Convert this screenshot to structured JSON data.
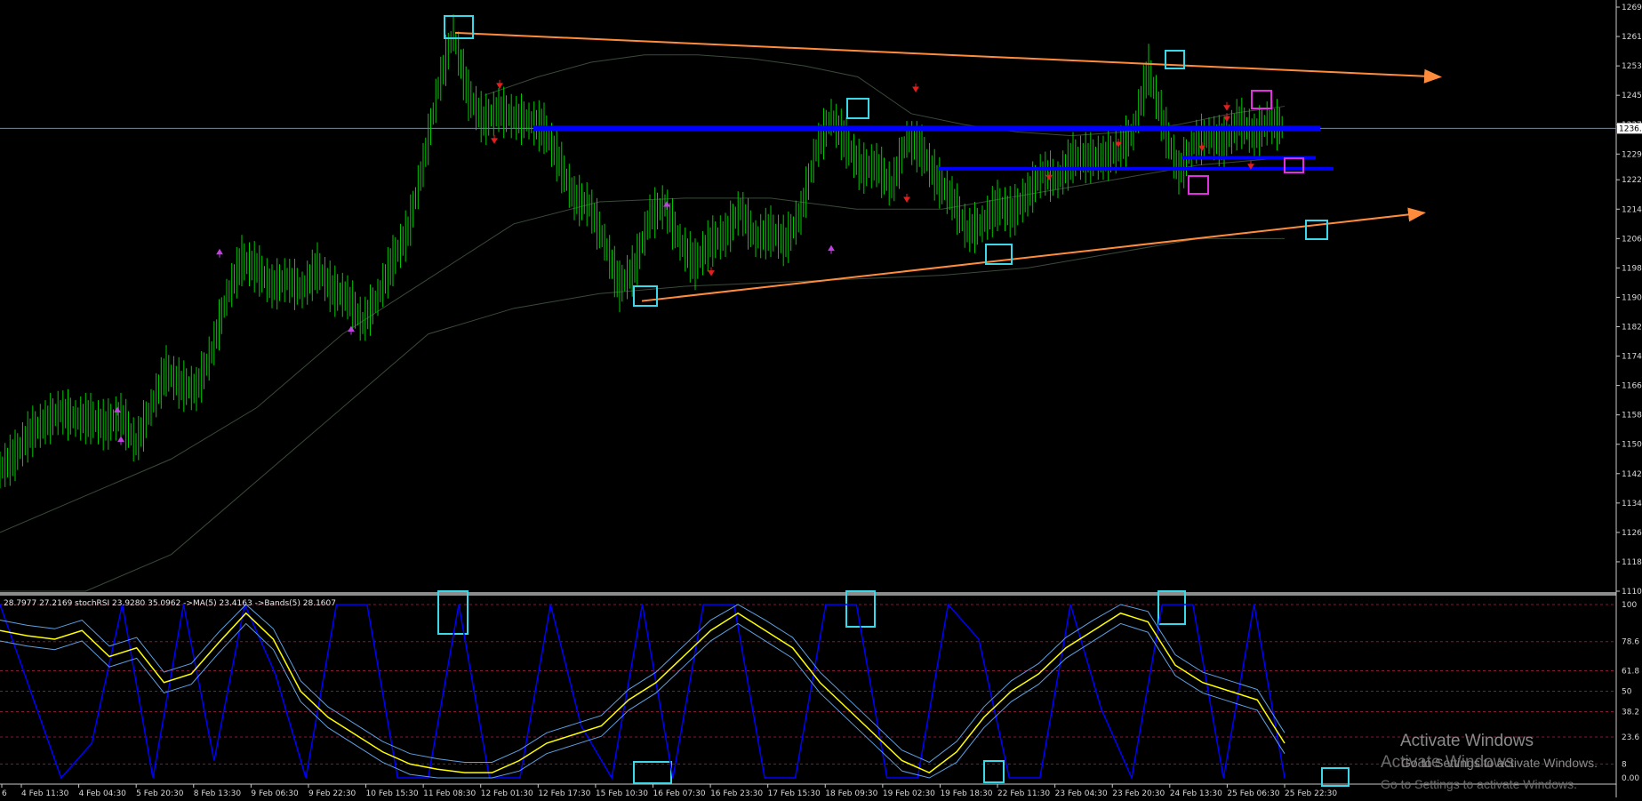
{
  "chart_data": [
    {
      "type": "line",
      "panel": "price",
      "y_ticks": [
        "1269",
        "1261",
        "1253",
        "1245",
        "1237",
        "1229",
        "1222",
        "1214",
        "1206",
        "1198",
        "1190",
        "1182",
        "1174",
        "1166",
        "1158",
        "1150",
        "1142",
        "1134",
        "1126",
        "1118",
        "1110"
      ],
      "ylim": [
        1110,
        1269
      ],
      "current_price_label": "1236.",
      "current_price": 1236,
      "x_tick_labels": [
        "6",
        "4 Feb 11:30",
        "4 Feb 04:30",
        "5 Feb 20:30",
        "8 Feb 13:30",
        "9 Feb 06:30",
        "9 Feb 22:30",
        "10 Feb 15:30",
        "11 Feb 08:30",
        "12 Feb 01:30",
        "12 Feb 17:30",
        "15 Feb 10:30",
        "16 Feb 07:30",
        "16 Feb 23:30",
        "17 Feb 15:30",
        "18 Feb 09:30",
        "19 Feb 02:30",
        "19 Feb 18:30",
        "22 Feb 11:30",
        "23 Feb 04:30",
        "23 Feb 20:30",
        "24 Feb 13:30",
        "25 Feb 06:30",
        "25 Feb 22:30"
      ],
      "series": [
        {
          "role": "price",
          "color": "#00c800",
          "values": [
            1143,
            1147,
            1153,
            1156,
            1159,
            1157,
            1157,
            1155,
            1158,
            1150,
            1160,
            1170,
            1166,
            1165,
            1175,
            1190,
            1200,
            1198,
            1193,
            1195,
            1192,
            1198,
            1192,
            1190,
            1183,
            1190,
            1200,
            1208,
            1226,
            1247,
            1262,
            1245,
            1238,
            1241,
            1239,
            1238,
            1236,
            1227,
            1217,
            1215,
            1205,
            1193,
            1198,
            1212,
            1215,
            1205,
            1199,
            1205,
            1207,
            1214,
            1206,
            1208,
            1205,
            1213,
            1230,
            1239,
            1232,
            1225,
            1226,
            1220,
            1233,
            1230,
            1222,
            1217,
            1208,
            1210,
            1215,
            1213,
            1218,
            1224,
            1222,
            1228,
            1228,
            1228,
            1230,
            1235,
            1252,
            1237,
            1224,
            1232,
            1234,
            1232,
            1238,
            1234,
            1238,
            1236
          ]
        },
        {
          "role": "envelope-upper",
          "color": "#3a4a3a",
          "values": [
            1245,
            1250,
            1254,
            1256,
            1256,
            1255,
            1253,
            1250,
            1240,
            1237,
            1235,
            1234,
            1235,
            1237,
            1240,
            1242
          ]
        },
        {
          "role": "envelope-mid",
          "color": "#3a4a3a",
          "values": [
            1126,
            1136,
            1146,
            1160,
            1180,
            1195,
            1210,
            1216,
            1217,
            1217,
            1214,
            1214,
            1218,
            1222,
            1226,
            1228
          ]
        },
        {
          "role": "envelope-lower",
          "color": "#3a4a3a",
          "values": [
            1110,
            1110,
            1120,
            1140,
            1160,
            1180,
            1187,
            1191,
            1193,
            1194,
            1195,
            1196,
            1198,
            1202,
            1206,
            1206
          ]
        }
      ],
      "trendlines": [
        {
          "name": "upper",
          "color": "#ff8c3c",
          "from": [
            1262
          ],
          "to": [
            1250
          ]
        },
        {
          "name": "lower",
          "color": "#ff8c3c",
          "from": [
            1189
          ],
          "to": [
            1213
          ]
        }
      ],
      "horizontal_levels": [
        {
          "color": "#0000ff",
          "value": 1236
        },
        {
          "color": "#0000ff",
          "value": 1228
        },
        {
          "color": "#0000ff",
          "value": 1225
        }
      ],
      "markers": {
        "red": [
          [
            1247
          ],
          [
            1232
          ],
          [
            1246
          ],
          [
            1216
          ],
          [
            1196
          ],
          [
            1238
          ],
          [
            1230
          ],
          [
            1222
          ],
          [
            1231
          ],
          [
            1241
          ],
          [
            1225
          ]
        ],
        "purple": [
          [
            1160
          ],
          [
            1152
          ],
          [
            1203
          ],
          [
            1182
          ],
          [
            1216
          ],
          [
            1204
          ]
        ]
      }
    },
    {
      "type": "line",
      "panel": "oscillator",
      "legend_text": "28.7977 27.2169 stochRSI 23.9280 35.0962 ->MA(5) 23.4163 ->Bands(5) 28.1607",
      "y_ticks": [
        "100",
        "78.6",
        "61.8",
        "50",
        "38.2",
        "23.6",
        "8",
        "0.00"
      ],
      "ylim": [
        0,
        100
      ],
      "series": [
        {
          "role": "stochRSI",
          "color": "#0000ff",
          "values": [
            100,
            50,
            0,
            20,
            100,
            0,
            100,
            10,
            100,
            60,
            0,
            100,
            100,
            0,
            0,
            100,
            0,
            0,
            100,
            30,
            0,
            100,
            0,
            100,
            100,
            0,
            0,
            100,
            100,
            0,
            0,
            100,
            80,
            0,
            0,
            100,
            40,
            0,
            100,
            100,
            0,
            100,
            0
          ]
        },
        {
          "role": "MA(5)",
          "color": "#ffff00",
          "values": [
            85,
            82,
            80,
            85,
            70,
            75,
            55,
            60,
            78,
            95,
            80,
            50,
            35,
            25,
            15,
            8,
            5,
            3,
            3,
            10,
            20,
            25,
            30,
            45,
            55,
            70,
            85,
            95,
            85,
            75,
            55,
            40,
            25,
            10,
            3,
            15,
            35,
            50,
            60,
            75,
            85,
            95,
            90,
            65,
            55,
            50,
            45,
            20
          ]
        }
      ]
    }
  ],
  "watermark": {
    "line1": "Activate Windows",
    "line2": "Go to Settings to activate Windows."
  }
}
